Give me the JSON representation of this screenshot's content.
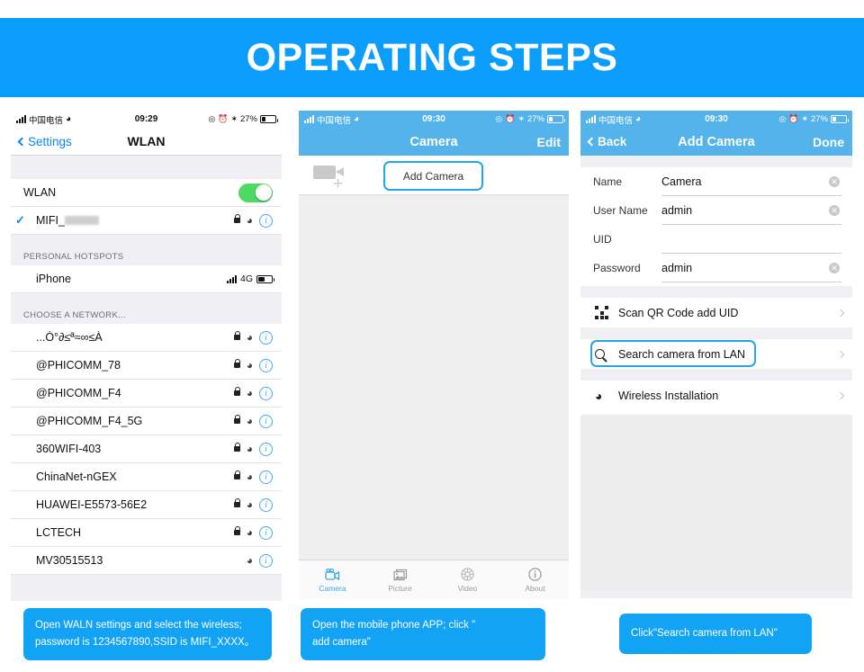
{
  "banner": {
    "title": "OPERATING STEPS",
    "bg": "#0b9dfb"
  },
  "panel1": {
    "status": {
      "carrier": "中国电信",
      "time": "09:29",
      "battery_pct": "27%"
    },
    "nav": {
      "back": "Settings",
      "title": "WLAN"
    },
    "wlan_toggle_row": {
      "label": "WLAN",
      "state": "on"
    },
    "connected_network": {
      "label": "MIFI_",
      "checked": true
    },
    "section_hotspots": "PERSONAL HOTSPOTS",
    "hotspot": {
      "label": "iPhone",
      "network_type": "4G"
    },
    "section_choose": "CHOOSE A NETWORK...",
    "networks": [
      {
        "ssid": "...Ò°∂≤ª≈∞≤À",
        "locked": true
      },
      {
        "ssid": "@PHICOMM_78",
        "locked": true
      },
      {
        "ssid": "@PHICOMM_F4",
        "locked": true
      },
      {
        "ssid": "@PHICOMM_F4_5G",
        "locked": true
      },
      {
        "ssid": "360WIFI-403",
        "locked": true
      },
      {
        "ssid": "ChinaNet-nGEX",
        "locked": true
      },
      {
        "ssid": "HUAWEI-E5573-56E2",
        "locked": true
      },
      {
        "ssid": "LCTECH",
        "locked": true
      },
      {
        "ssid": "MV30515513",
        "locked": false
      }
    ]
  },
  "panel2": {
    "status": {
      "carrier": "中国电信",
      "time": "09:30",
      "battery_pct": "27%"
    },
    "nav": {
      "title": "Camera",
      "right": "Edit"
    },
    "add_camera_button": "Add Camera",
    "tabs": [
      {
        "label": "Camera",
        "icon": "camcorder-icon",
        "active": true
      },
      {
        "label": "Picture",
        "icon": "picture-icon",
        "active": false
      },
      {
        "label": "Video",
        "icon": "video-icon",
        "active": false
      },
      {
        "label": "About",
        "icon": "info-icon",
        "active": false
      }
    ]
  },
  "panel3": {
    "status": {
      "carrier": "中国电信",
      "time": "09:30",
      "battery_pct": "27%"
    },
    "nav": {
      "back": "Back",
      "title": "Add Camera",
      "right": "Done"
    },
    "fields": [
      {
        "label": "Name",
        "value": "Camera",
        "clearable": true
      },
      {
        "label": "User Name",
        "value": "admin",
        "clearable": true
      },
      {
        "label": "UID",
        "value": "",
        "clearable": false
      },
      {
        "label": "Password",
        "value": "admin",
        "clearable": true
      }
    ],
    "actions": [
      {
        "label": "Scan QR Code add UID",
        "icon": "qr-code-icon",
        "highlighted": false
      },
      {
        "label": "Search camera from LAN",
        "icon": "search-icon",
        "highlighted": true
      },
      {
        "label": "Wireless Installation",
        "icon": "wifi-icon",
        "highlighted": false
      }
    ]
  },
  "captions": {
    "one_line1": "Open WALN settings and select the wireless;",
    "one_line2": "password is 1234567890,SSID is MIFI_XXXX。",
    "two_line1": "Open the mobile phone APP; click \"",
    "two_line2": "add camera\"",
    "three": "Click\"Search camera from LAN\""
  }
}
